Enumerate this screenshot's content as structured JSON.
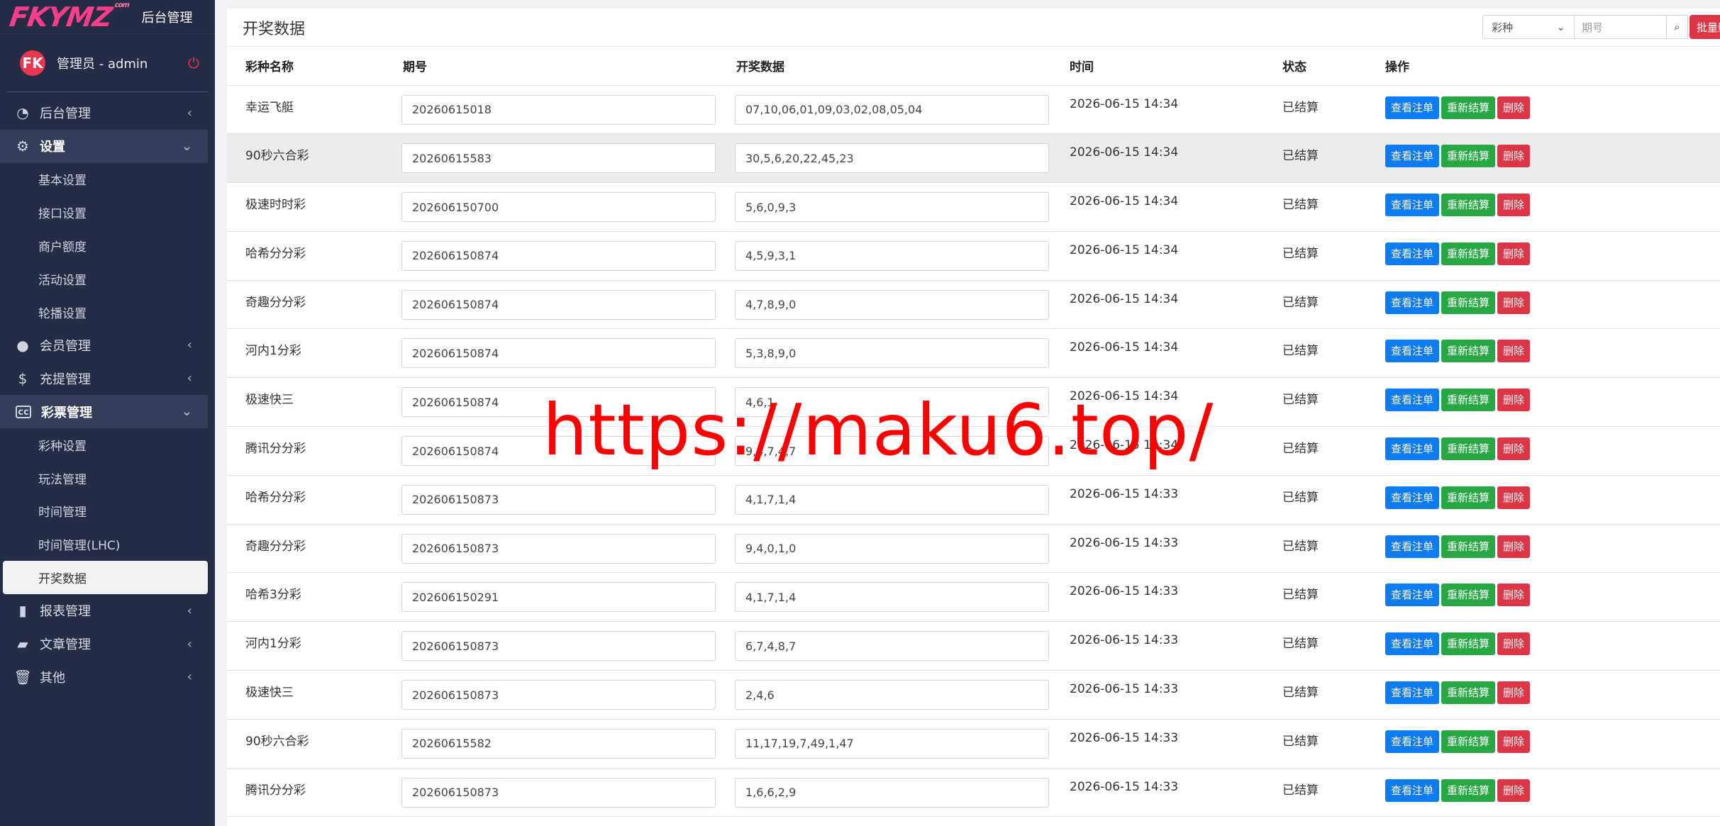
{
  "brand": {
    "logo": "FKYMZ",
    "logo_small": "com",
    "title": "后台管理"
  },
  "user": {
    "avatar": "FK",
    "name": "管理员 - admin"
  },
  "menu": {
    "items": [
      {
        "label": "后台管理",
        "icon": "dashboard-icon"
      },
      {
        "label": "设置",
        "icon": "gear-icon"
      },
      {
        "label": "基本设置"
      },
      {
        "label": "接口设置"
      },
      {
        "label": "商户额度"
      },
      {
        "label": "活动设置"
      },
      {
        "label": "轮播设置"
      },
      {
        "label": "会员管理",
        "icon": "user-icon"
      },
      {
        "label": "充提管理",
        "icon": "dollar-icon"
      },
      {
        "label": "彩票管理",
        "icon": "cc-icon"
      },
      {
        "label": "彩种设置"
      },
      {
        "label": "玩法管理"
      },
      {
        "label": "时间管理"
      },
      {
        "label": "时间管理(LHC)"
      },
      {
        "label": "开奖数据"
      },
      {
        "label": "报表管理",
        "icon": "file-icon"
      },
      {
        "label": "文章管理",
        "icon": "book-icon"
      },
      {
        "label": "其他",
        "icon": "trash-icon"
      }
    ]
  },
  "page": {
    "title": "开奖数据"
  },
  "search": {
    "select_value": "彩种",
    "placeholder": "期号",
    "batch_label": "批量删除"
  },
  "table": {
    "headers": [
      "彩种名称",
      "期号",
      "开奖数据",
      "时间",
      "状态",
      "操作"
    ],
    "actions": {
      "view": "查看注单",
      "resettle": "重新结算",
      "delete": "删除"
    },
    "rows": [
      {
        "name": "幸运飞艇",
        "period": "20260615018",
        "result": "07,10,06,01,09,03,02,08,05,04",
        "time": "2026-06-15 14:34",
        "status": "已结算"
      },
      {
        "name": "90秒六合彩",
        "period": "20260615583",
        "result": "30,5,6,20,22,45,23",
        "time": "2026-06-15 14:34",
        "status": "已结算"
      },
      {
        "name": "极速时时彩",
        "period": "202606150700",
        "result": "5,6,0,9,3",
        "time": "2026-06-15 14:34",
        "status": "已结算"
      },
      {
        "name": "哈希分分彩",
        "period": "202606150874",
        "result": "4,5,9,3,1",
        "time": "2026-06-15 14:34",
        "status": "已结算"
      },
      {
        "name": "奇趣分分彩",
        "period": "202606150874",
        "result": "4,7,8,9,0",
        "time": "2026-06-15 14:34",
        "status": "已结算"
      },
      {
        "name": "河内1分彩",
        "period": "202606150874",
        "result": "5,3,8,9,0",
        "time": "2026-06-15 14:34",
        "status": "已结算"
      },
      {
        "name": "极速快三",
        "period": "202606150874",
        "result": "4,6,1",
        "time": "2026-06-15 14:34",
        "status": "已结算"
      },
      {
        "name": "腾讯分分彩",
        "period": "202606150874",
        "result": "9,4,7,4,7",
        "time": "2026-06-15 14:34",
        "status": "已结算"
      },
      {
        "name": "哈希分分彩",
        "period": "202606150873",
        "result": "4,1,7,1,4",
        "time": "2026-06-15 14:33",
        "status": "已结算"
      },
      {
        "name": "奇趣分分彩",
        "period": "202606150873",
        "result": "9,4,0,1,0",
        "time": "2026-06-15 14:33",
        "status": "已结算"
      },
      {
        "name": "哈希3分彩",
        "period": "202606150291",
        "result": "4,1,7,1,4",
        "time": "2026-06-15 14:33",
        "status": "已结算"
      },
      {
        "name": "河内1分彩",
        "period": "202606150873",
        "result": "6,7,4,8,7",
        "time": "2026-06-15 14:33",
        "status": "已结算"
      },
      {
        "name": "极速快三",
        "period": "202606150873",
        "result": "2,4,6",
        "time": "2026-06-15 14:33",
        "status": "已结算"
      },
      {
        "name": "90秒六合彩",
        "period": "20260615582",
        "result": "11,17,19,7,49,1,47",
        "time": "2026-06-15 14:33",
        "status": "已结算"
      },
      {
        "name": "腾讯分分彩",
        "period": "202606150873",
        "result": "1,6,6,2,9",
        "time": "2026-06-15 14:33",
        "status": "已结算"
      }
    ]
  },
  "watermark": "https://maku6.top/",
  "colors": {
    "sidebar": "#252d46",
    "primary": "#0d7bf2",
    "success": "#28a745",
    "danger": "#dc3545",
    "logo": "#ff3d8b"
  }
}
